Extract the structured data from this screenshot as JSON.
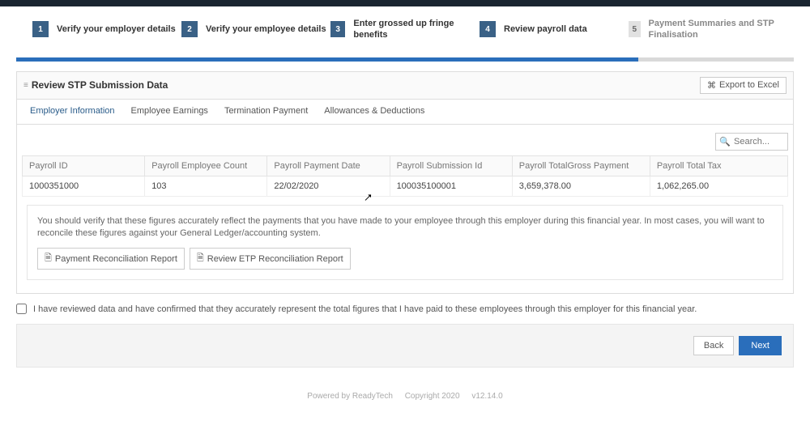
{
  "stepper": {
    "steps": [
      {
        "num": "1",
        "label": "Verify your employer details",
        "active": true
      },
      {
        "num": "2",
        "label": "Verify your employee details",
        "active": true
      },
      {
        "num": "3",
        "label": "Enter grossed up fringe benefits",
        "active": true
      },
      {
        "num": "4",
        "label": "Review payroll data",
        "active": true
      },
      {
        "num": "5",
        "label": "Payment Summaries and STP Finalisation",
        "active": false
      }
    ]
  },
  "panel": {
    "title": "Review STP Submission Data",
    "export_label": "Export to Excel"
  },
  "tabs": {
    "items": [
      "Employer Information",
      "Employee Earnings",
      "Termination Payment",
      "Allowances & Deductions"
    ],
    "active_index": 0
  },
  "search": {
    "placeholder": "Search..."
  },
  "table": {
    "headers": [
      "Payroll ID",
      "Payroll Employee Count",
      "Payroll Payment Date",
      "Payroll Submission Id",
      "Payroll TotalGross Payment",
      "Payroll Total Tax"
    ],
    "row": {
      "payroll_id": "1000351000",
      "employee_count": "103",
      "payment_date": "22/02/2020",
      "submission_id": "100035100001",
      "gross_payment": "3,659,378.00",
      "total_tax": "1,062,265.00"
    }
  },
  "note": {
    "text": "You should verify that these figures accurately reflect the payments that you have made to your employee through this employer during this financial year. In most cases, you will want to reconcile these figures against your General Ledger/accounting system.",
    "btn_payment": "Payment Reconciliation Report",
    "btn_etp": "Review ETP Reconciliation Report"
  },
  "confirm": {
    "label": "I have reviewed data and have confirmed that they accurately represent the total figures that I have paid to these employees through this employer for this financial year."
  },
  "footer": {
    "back": "Back",
    "next": "Next"
  },
  "credits": {
    "powered": "Powered by ReadyTech",
    "copyright": "Copyright 2020",
    "version": "v12.14.0"
  }
}
